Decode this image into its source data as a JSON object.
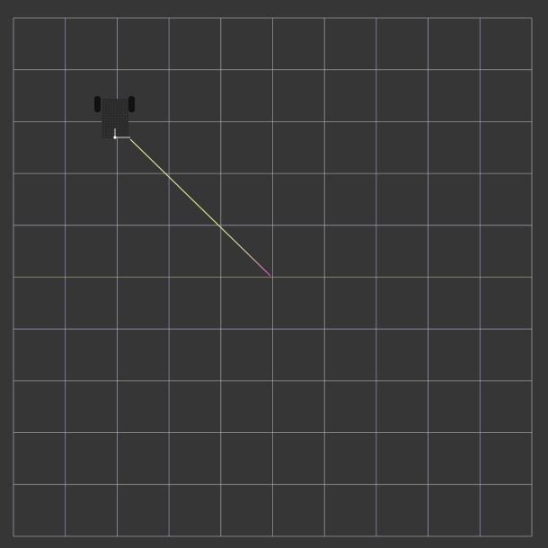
{
  "scene": {
    "background_color": "#363636",
    "grid": {
      "visible": true,
      "cells": 10,
      "line_color_light": "#b8b8c8",
      "line_color_warm": "#b9b9a0",
      "line_color_cool": "#a8a8cc"
    },
    "path": {
      "visible": true,
      "start_color": "#e8e89a",
      "end_color": "#d060c8",
      "start_cell": [
        2,
        2.3
      ],
      "end_cell": [
        5,
        5
      ]
    },
    "robot": {
      "icon": "robot-icon",
      "body_color": "#2a2a2a",
      "wheel_color": "#111111",
      "axis_color": "#dddddd",
      "center_cell": [
        2,
        2.3
      ]
    }
  }
}
